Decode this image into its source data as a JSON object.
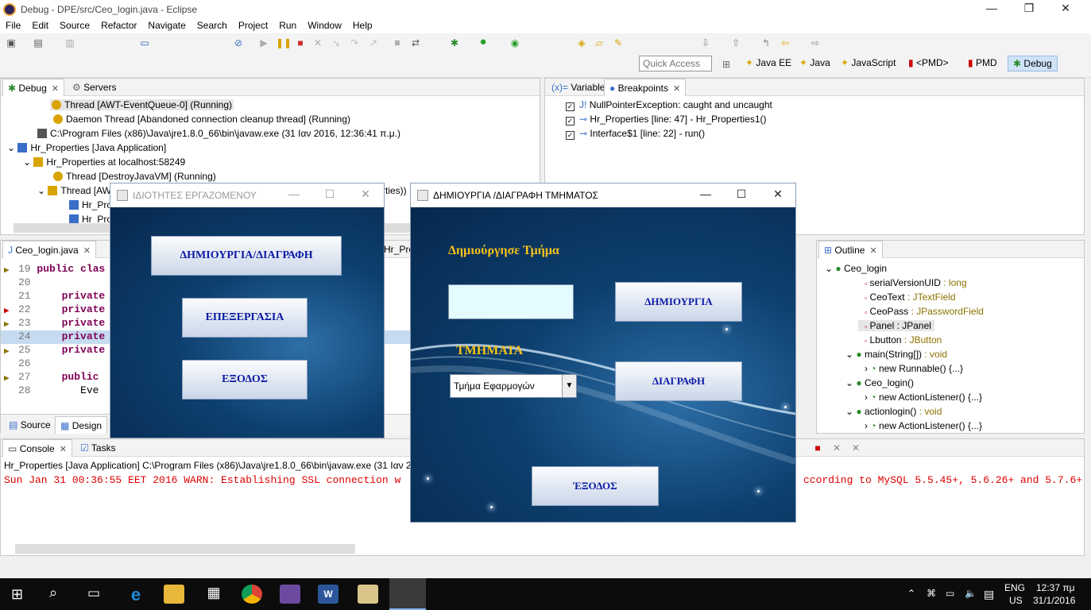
{
  "window": {
    "title": "Debug - DPE/src/Ceo_login.java - Eclipse"
  },
  "menu": [
    "File",
    "Edit",
    "Source",
    "Refactor",
    "Navigate",
    "Search",
    "Project",
    "Run",
    "Window",
    "Help"
  ],
  "quick_access": {
    "placeholder": "Quick Access"
  },
  "perspectives": [
    "Java EE",
    "Java",
    "JavaScript",
    "<PMD>",
    "PMD",
    "Debug"
  ],
  "debug_view": {
    "tabs": [
      "Debug",
      "Servers"
    ],
    "rows": [
      "Thread [AWT-EventQueue-0] (Running)",
      "Daemon Thread [Abandoned connection cleanup thread] (Running)",
      "C:\\Program Files (x86)\\Java\\jre1.8.0_66\\bin\\javaw.exe (31 Ιαν 2016, 12:36:41 π.μ.)",
      "Hr_Properties [Java Application]",
      "Hr_Properties at localhost:58249",
      "Thread [DestroyJavaVM] (Running)",
      "Thread [AW",
      "Hr_Pro",
      "Hr_Pro"
    ],
    "overflow_text": "rties))"
  },
  "breakpoints_view": {
    "tabs": [
      "Variables",
      "Breakpoints"
    ],
    "items": [
      "NullPointerException: caught and uncaught",
      "Hr_Properties [line: 47] - Hr_Properties1()",
      "Interface$1 [line: 22] - run()"
    ]
  },
  "editor": {
    "tabs": [
      "Ceo_login.java",
      "Hr_Pro"
    ],
    "lines": [
      {
        "num": "19",
        "text": "public clas"
      },
      {
        "num": "20",
        "text": ""
      },
      {
        "num": "21",
        "text": "private"
      },
      {
        "num": "22",
        "text": "private"
      },
      {
        "num": "23",
        "text": "private"
      },
      {
        "num": "24",
        "text": "private"
      },
      {
        "num": "25",
        "text": "private"
      },
      {
        "num": "26",
        "text": ""
      },
      {
        "num": "27",
        "text": "public"
      },
      {
        "num": "28",
        "text": "Eve"
      }
    ],
    "bottom_tabs": [
      "Source",
      "Design"
    ]
  },
  "outline": {
    "tab": "Outline",
    "items": [
      {
        "name": "Ceo_login",
        "type": ""
      },
      {
        "name": "serialVersionUID",
        "type": " : long"
      },
      {
        "name": "CeoText",
        "type": " : JTextField"
      },
      {
        "name": "CeoPass",
        "type": " : JPasswordField"
      },
      {
        "name": "Panel",
        "type": " : JPanel"
      },
      {
        "name": "Lbutton",
        "type": " : JButton"
      },
      {
        "name": "main(String[])",
        "type": " : void"
      },
      {
        "name": "new Runnable() {...}",
        "type": ""
      },
      {
        "name": "Ceo_login()",
        "type": ""
      },
      {
        "name": "new ActionListener() {...}",
        "type": ""
      },
      {
        "name": "actionlogin()",
        "type": " : void"
      },
      {
        "name": "new ActionListener() {...}",
        "type": ""
      }
    ]
  },
  "console": {
    "tabs": [
      "Console",
      "Tasks"
    ],
    "header": "Hr_Properties [Java Application] C:\\Program Files (x86)\\Java\\jre1.8.0_66\\bin\\javaw.exe (31 Ιαν 2016",
    "line_left": "Sun Jan 31 00:36:55 EET 2016 WARN: Establishing SSL connection w",
    "line_right": "ccording to MySQL 5.5.45+, 5.6.26+ and 5.7.6+"
  },
  "props_window": {
    "title": "ΙΔΙΟΤΗΤΕΣ ΕΡΓΑΖΟΜΕΝΟΥ",
    "buttons": [
      "ΔΗΜΙΟΥΡΓΙΑ/ΔΙΑΓΡΑΦΗ",
      "ΕΠΕΞΕΡΓΑΣΙΑ",
      "ΕΞΟΔΟΣ"
    ]
  },
  "dept_window": {
    "title": "ΔΗΜΙΟΥΡΓΙΑ /ΔΙΑΓΡΑΦΗ ΤΜΗΜΑΤΟΣ",
    "create_label": "Δημιούργησε Τμήμα",
    "input_value": "",
    "create_button": "ΔΗΜΙΟΥΡΓΙΑ",
    "departments_label": "ΤΜΗΜΑΤΑ",
    "dept_selected": "Τμήμα Εφαρμογών",
    "delete_button": "ΔΙΑΓΡΑΦΗ",
    "exit_button": "ΈΞΟΔΟΣ"
  },
  "taskbar": {
    "lang": "ENG",
    "region": "US",
    "time": "12:37 πμ",
    "date": "31/1/2016"
  },
  "colors": {
    "accent": "#f7c21b",
    "button_text": "#0b1aa5",
    "console_error": "#e00000"
  }
}
